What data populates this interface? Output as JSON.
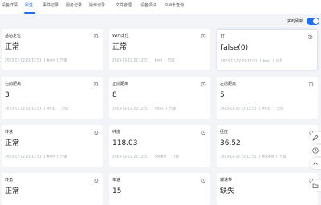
{
  "tabs": [
    {
      "label": "设备详情"
    },
    {
      "label": "属性"
    },
    {
      "label": "事件记录"
    },
    {
      "label": "服务记录"
    },
    {
      "label": "操作记录"
    },
    {
      "label": "文件管理"
    },
    {
      "label": "设备调试"
    },
    {
      "label": "SIM卡查询"
    }
  ],
  "active_tab": "属性",
  "realtime": {
    "label": "实时刷新",
    "on": true
  },
  "cards": [
    {
      "name": "基站定位",
      "value": "正常",
      "time": "2023-12-12 22:12:51",
      "type": "bool",
      "access": "只读"
    },
    {
      "name": "WIFI定位",
      "value": "正常",
      "time": "2023-12-12 22:12:51",
      "type": "bool",
      "access": "只读"
    },
    {
      "name": "灯",
      "value": "false(0)",
      "time": "2023-12-12 22:12:51",
      "type": "bool",
      "access": "读写"
    },
    {
      "name": "右前距离",
      "value": "3",
      "time": "2023-12-12 22:12:51",
      "type": "int32",
      "access": "只读"
    },
    {
      "name": "正前距离",
      "value": "8",
      "time": "2023-12-12 22:12:51",
      "type": "int32",
      "access": "只读"
    },
    {
      "name": "左前距离",
      "value": "5",
      "time": "2023-12-12 22:12:51",
      "type": "int32",
      "access": "只读"
    },
    {
      "name": "转速",
      "value": "正常",
      "time": "2023-12-12 22:12:51",
      "type": "bool",
      "access": "只读"
    },
    {
      "name": "纬度",
      "value": "118.03",
      "time": "2023-12-12 22:12:51",
      "type": "double",
      "access": "只读"
    },
    {
      "name": "经度",
      "value": "36.52",
      "time": "2023-12-12 22:12:51",
      "type": "double",
      "access": "只读"
    },
    {
      "name": "转角",
      "value": "正常",
      "time": "",
      "type": "",
      "access": ""
    },
    {
      "name": "车速",
      "value": "15",
      "time": "",
      "type": "",
      "access": ""
    },
    {
      "name": "减速带",
      "value": "缺失",
      "time": "",
      "type": "",
      "access": ""
    }
  ],
  "colors": {
    "accent": "#1f6fff",
    "background": "#f3f4f7",
    "card": "#ffffff"
  },
  "icons": {
    "history": "history-icon",
    "side": [
      "edit-icon",
      "help-icon",
      "top-icon"
    ]
  }
}
